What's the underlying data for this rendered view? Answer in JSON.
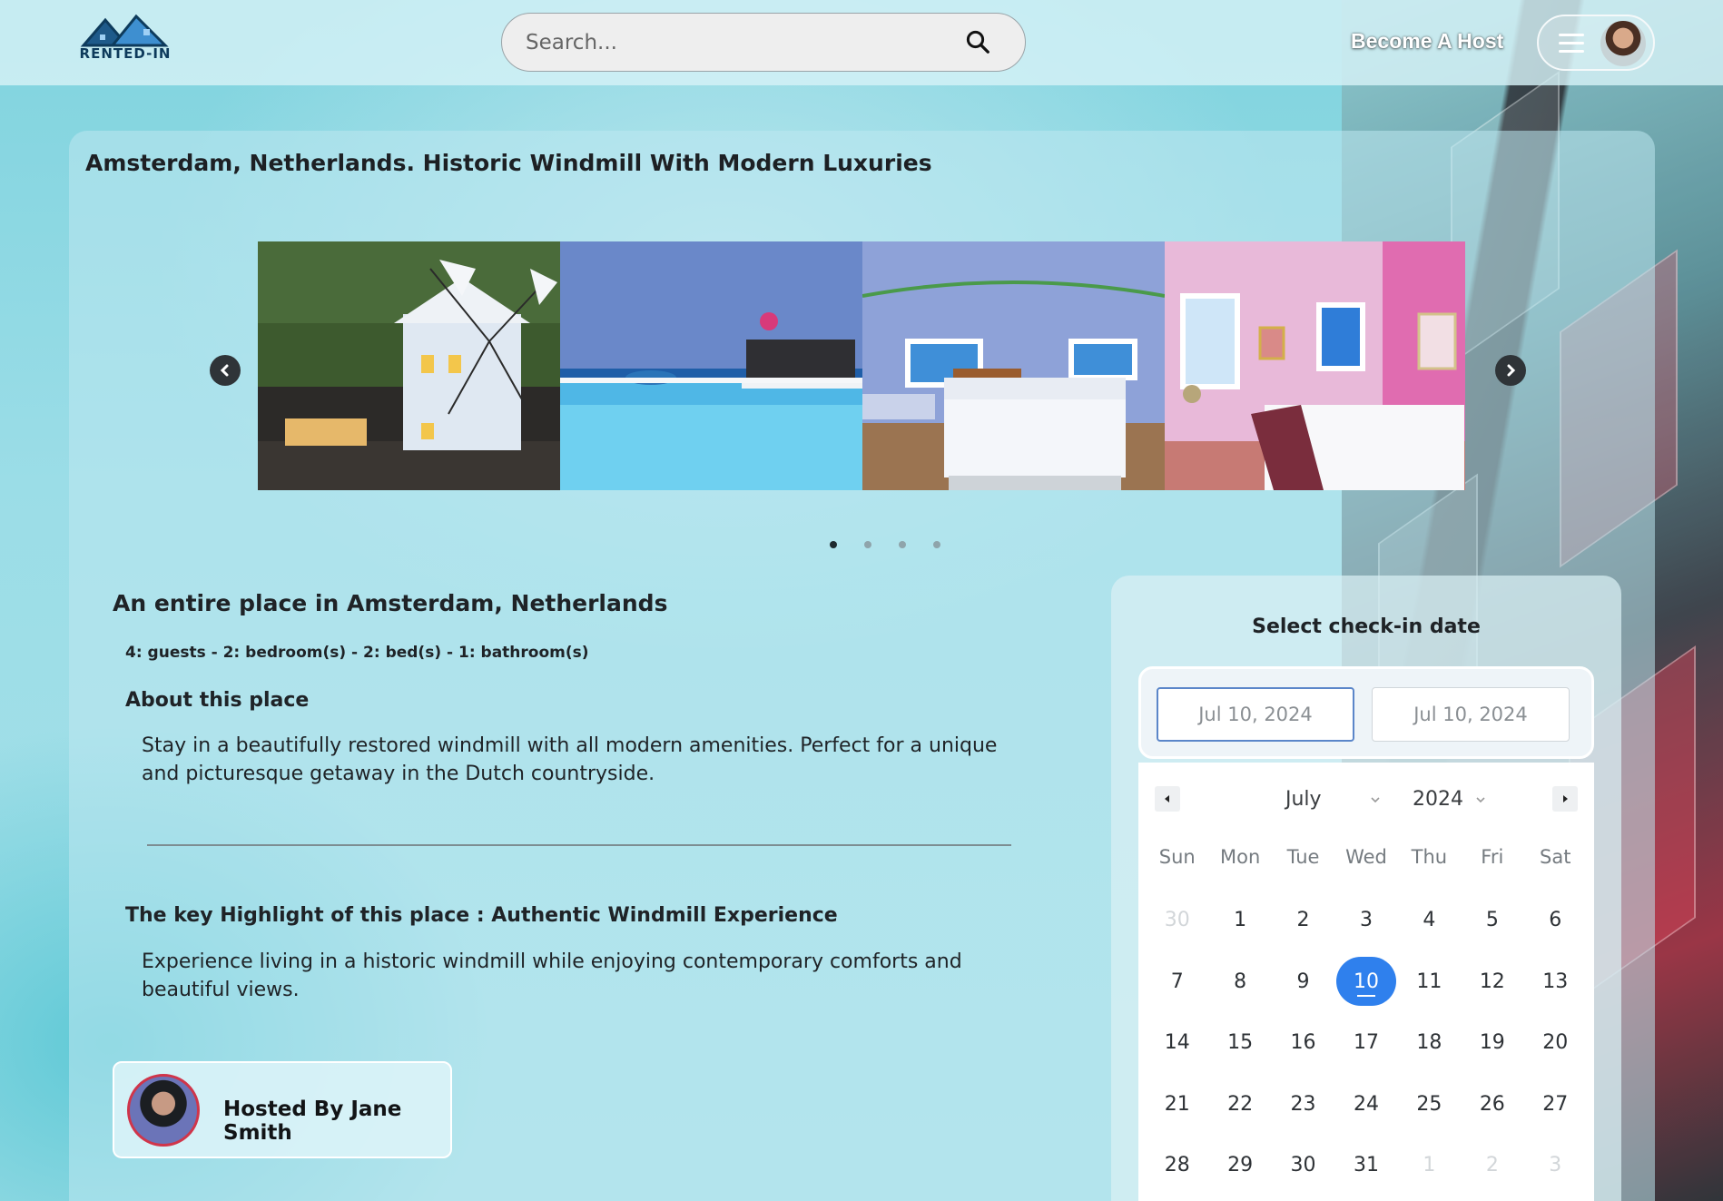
{
  "header": {
    "logo_text": "RENTED-IN",
    "search": {
      "placeholder": "Search..."
    },
    "become_host_label": "Become A Host"
  },
  "listing": {
    "title": "Amsterdam, Netherlands. Historic Windmill With Modern Luxuries",
    "carousel": {
      "slides": [
        "windmill-exterior",
        "infinity-pool",
        "blue-bedroom",
        "pink-bedroom"
      ],
      "dot_count": 4,
      "active_dot": 1
    },
    "place_heading": "An entire place in Amsterdam, Netherlands",
    "specs": "4: guests - 2: bedroom(s) - 2: bed(s) - 1: bathroom(s)",
    "about_heading": "About this place",
    "about_text": "Stay in a beautifully restored windmill with all modern amenities. Perfect for a unique and picturesque getaway in the Dutch countryside.",
    "highlight_heading": "The key Highlight of this place : Authentic Windmill Experience",
    "highlight_text": "Experience living in a historic windmill while enjoying contemporary comforts and beautiful views.",
    "host_label": "Hosted By Jane Smith"
  },
  "booking": {
    "title": "Select check-in date",
    "start_date": "Jul 10, 2024",
    "end_date": "Jul 10, 2024",
    "calendar": {
      "month": "July",
      "year": "2024",
      "weekdays": [
        "Sun",
        "Mon",
        "Tue",
        "Wed",
        "Thu",
        "Fri",
        "Sat"
      ],
      "weeks": [
        [
          "30",
          "1",
          "2",
          "3",
          "4",
          "5",
          "6"
        ],
        [
          "7",
          "8",
          "9",
          "10",
          "11",
          "12",
          "13"
        ],
        [
          "14",
          "15",
          "16",
          "17",
          "18",
          "19",
          "20"
        ],
        [
          "21",
          "22",
          "23",
          "24",
          "25",
          "26",
          "27"
        ],
        [
          "28",
          "29",
          "30",
          "31",
          "1",
          "2",
          "3"
        ]
      ],
      "selected_day": "10"
    }
  },
  "colors": {
    "accent": "#2f80ed",
    "logo": "#0e3b5c",
    "host_ring": "#d0354a"
  }
}
